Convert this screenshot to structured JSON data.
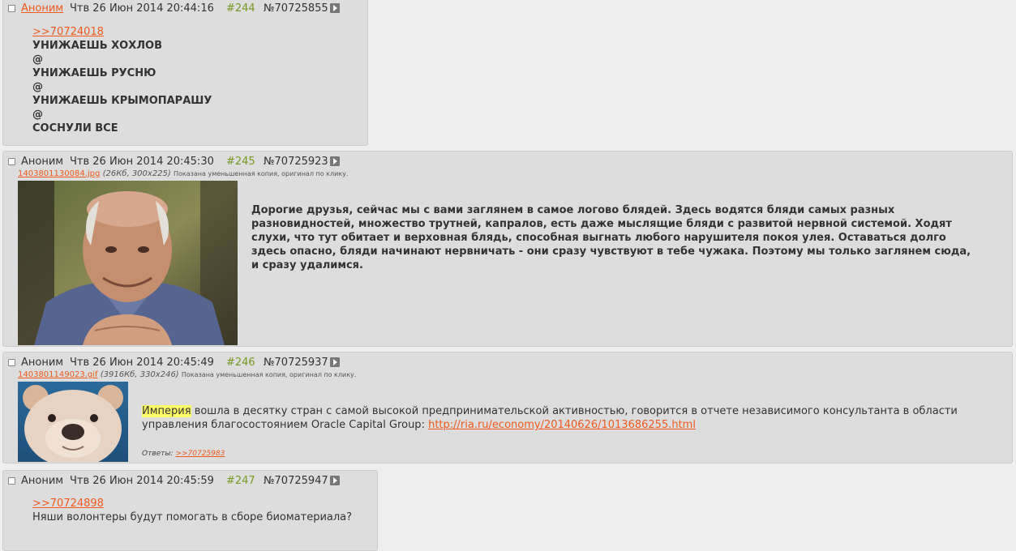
{
  "posts": [
    {
      "author": "Аноним",
      "datetime": "Чтв 26 Июн 2014 20:44:16",
      "hash_num": "#244",
      "post_id": "№70725855",
      "reply_ref": ">>70724018",
      "lines": [
        "УНИЖАЕШЬ ХОХЛОВ",
        "@",
        "УНИЖАЕШЬ РУСНЮ",
        "@",
        "УНИЖАЕШЬ КРЫМОПАРАШУ",
        "@",
        "СОСНУЛИ ВСЕ"
      ]
    },
    {
      "author": "Аноним",
      "datetime": "Чтв 26 Июн 2014 20:45:30",
      "hash_num": "#245",
      "post_id": "№70725923",
      "file_name": "1403801130084.jpg",
      "file_meta": "(26Кб, 300x225)",
      "file_note": "Показана уменьшенная копия, оригинал по клику.",
      "text_lines": [
        "Дорогие друзья, сейчас мы с вами заглянем в самое логово блядей. Здесь водятся бляди самых разных",
        "разновидностей, множество трутней, капралов, есть даже мыслящие бляди с развитой нервной системой. Ходят",
        "слухи, что тут обитает и верховная блядь, способная выгнать любого нарушителя покоя улея. Оставаться долго",
        "здесь опасно, бляди начинают нервничать - они сразу чувствуют в тебе чужака. Поэтому мы только заглянем сюда,",
        "и сразу удалимся."
      ]
    },
    {
      "author": "Аноним",
      "datetime": "Чтв 26 Июн 2014 20:45:49",
      "hash_num": "#246",
      "post_id": "№70725937",
      "file_name": "1403801149023.gif",
      "file_meta": "(3916Кб, 330x246)",
      "file_note": "Показана уменьшенная копия, оригинал по клику.",
      "highlight_word": "Империя",
      "text_line1_rest": " вошла в десятку стран с самой высокой предпринимательской активностью, говорится в отчете независимого консультанта в области",
      "text_line2_prefix": "управления благосостоянием Oracle Capital Group: ",
      "link": "http://ria.ru/economy/20140626/1013686255.html",
      "replies_label": "Ответы:",
      "replies_ref": ">>70725983"
    },
    {
      "author": "Аноним",
      "datetime": "Чтв 26 Июн 2014 20:45:59",
      "hash_num": "#247",
      "post_id": "№70725947",
      "reply_ref": ">>70724898",
      "text": "Няши волонтеры будут помогать в сборе биоматериала?"
    }
  ],
  "colors": {
    "link": "#f05a1e",
    "post_number": "#789922",
    "post_bg": "#dddddd",
    "page_bg": "#eeeeee",
    "highlight": "#ffff66"
  }
}
